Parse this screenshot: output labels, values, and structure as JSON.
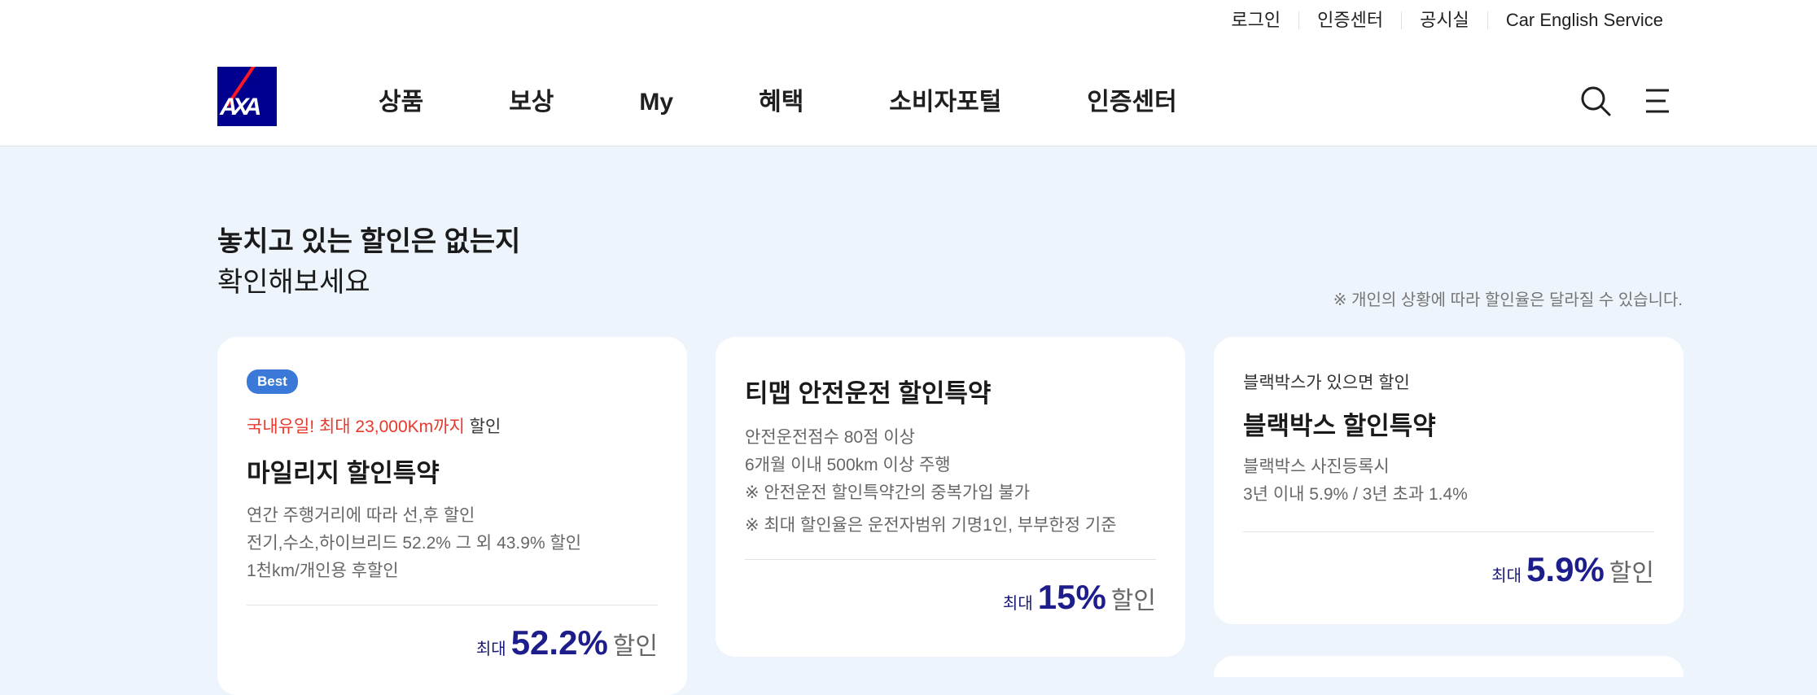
{
  "util_links": [
    "로그인",
    "인증센터",
    "공시실",
    "Car English Service"
  ],
  "logo_text": "AXA",
  "gnb": [
    "상품",
    "보상",
    "My",
    "혜택",
    "소비자포털",
    "인증센터"
  ],
  "section": {
    "title_strong": "놓치고 있는 할인은 없는지",
    "title_light": "확인해보세요",
    "notice": "※ 개인의 상황에 따라 할인율은 달라질 수 있습니다."
  },
  "cards": [
    {
      "badge": "Best",
      "eyebrow_red": "국내유일! 최대 23,000Km까지",
      "eyebrow_rest": " 할인",
      "title": "마일리지 할인특약",
      "desc": [
        "연간 주행거리에 따라 선,후 할인",
        "전기,수소,하이브리드 52.2% 그 외 43.9% 할인",
        "1천km/개인용 후할인"
      ],
      "price_label": "최대",
      "price_value": "52.2%",
      "price_unit": "할인"
    },
    {
      "title": "티맵 안전운전 할인특약",
      "desc": [
        "안전운전점수 80점 이상",
        "6개월 이내 500km 이상 주행",
        "※ 안전운전 할인특약간의 중복가입 불가",
        "※ 최대 할인율은 운전자범위 기명1인, 부부한정 기준"
      ],
      "price_label": "최대",
      "price_value": "15%",
      "price_unit": "할인"
    },
    {
      "eyebrow": "블랙박스가 있으면 할인",
      "title": "블랙박스 할인특약",
      "desc": [
        "블랙박스 사진등록시",
        "3년 이내 5.9% / 3년 초과 1.4%"
      ],
      "price_label": "최대",
      "price_value": "5.9%",
      "price_unit": "할인"
    }
  ],
  "colors": {
    "brand_blue": "#00008f",
    "brand_red": "#ff1721",
    "badge_blue": "#3b79d8",
    "price_blue": "#1d1d8c",
    "highlight_red": "#e8372b",
    "page_bg": "#eef4fb"
  },
  "icons": [
    "search-icon",
    "menu-icon"
  ]
}
